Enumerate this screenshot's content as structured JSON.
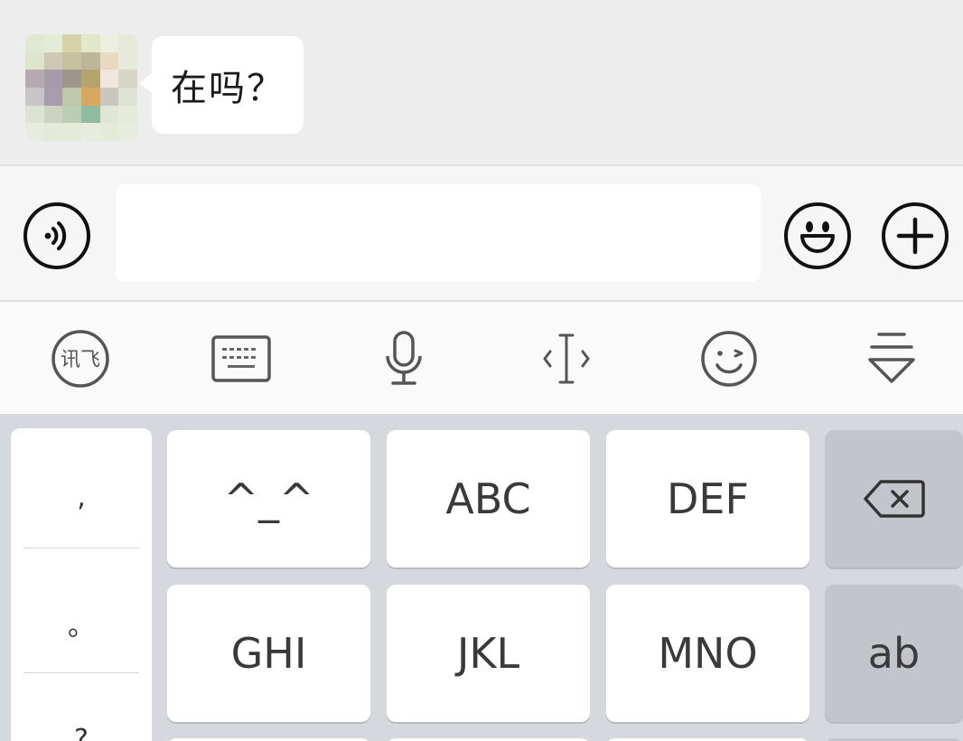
{
  "chat": {
    "message": "在吗？",
    "avatar_pixels": [
      "#dfe9d2",
      "#e3ecd6",
      "#d9d2a9",
      "#e2e7c8",
      "#ecefe0",
      "#e6ead9",
      "#dde6cb",
      "#cfc7b5",
      "#c6c2a0",
      "#bdb799",
      "#e9d9c3",
      "#e7ead8",
      "#b7a8b1",
      "#a59baa",
      "#9d968a",
      "#b4a56f",
      "#f1e7dd",
      "#d8d4c6",
      "#c9c4c8",
      "#a89cad",
      "#bfc9a9",
      "#d9a85f",
      "#c9c6bf",
      "#dfe3d3",
      "#dde3d2",
      "#cdd3c0",
      "#b8cfb3",
      "#8fbba0",
      "#dfe6d6",
      "#e6ead9",
      "#e8ecdf",
      "#e4e9d8",
      "#e6ead9",
      "#e8ecdf",
      "#e6ead9",
      "#e8ecdf"
    ]
  },
  "input_bar": {
    "voice_icon": "voice-icon",
    "emoji_icon": "smiley-icon",
    "plus_icon": "plus-icon",
    "text_value": ""
  },
  "toolbar": {
    "items": [
      "ifly-logo-icon",
      "keyboard-icon",
      "microphone-icon",
      "cursor-icon",
      "wink-emoji-icon",
      "collapse-icon"
    ],
    "ifly_label": "讯飞"
  },
  "keyboard": {
    "punctuation": [
      ",",
      "。",
      "?"
    ],
    "row1": [
      "^_^",
      "ABC",
      "DEF"
    ],
    "row2": [
      "GHI",
      "JKL",
      "MNO"
    ],
    "switch_label": "ab",
    "backspace_icon": "backspace-icon"
  },
  "colors": {
    "chat_bg": "#ededed",
    "keyboard_bg": "#d5d8dc",
    "key_bg": "#ffffff",
    "function_key_bg": "#c2c5ca"
  }
}
